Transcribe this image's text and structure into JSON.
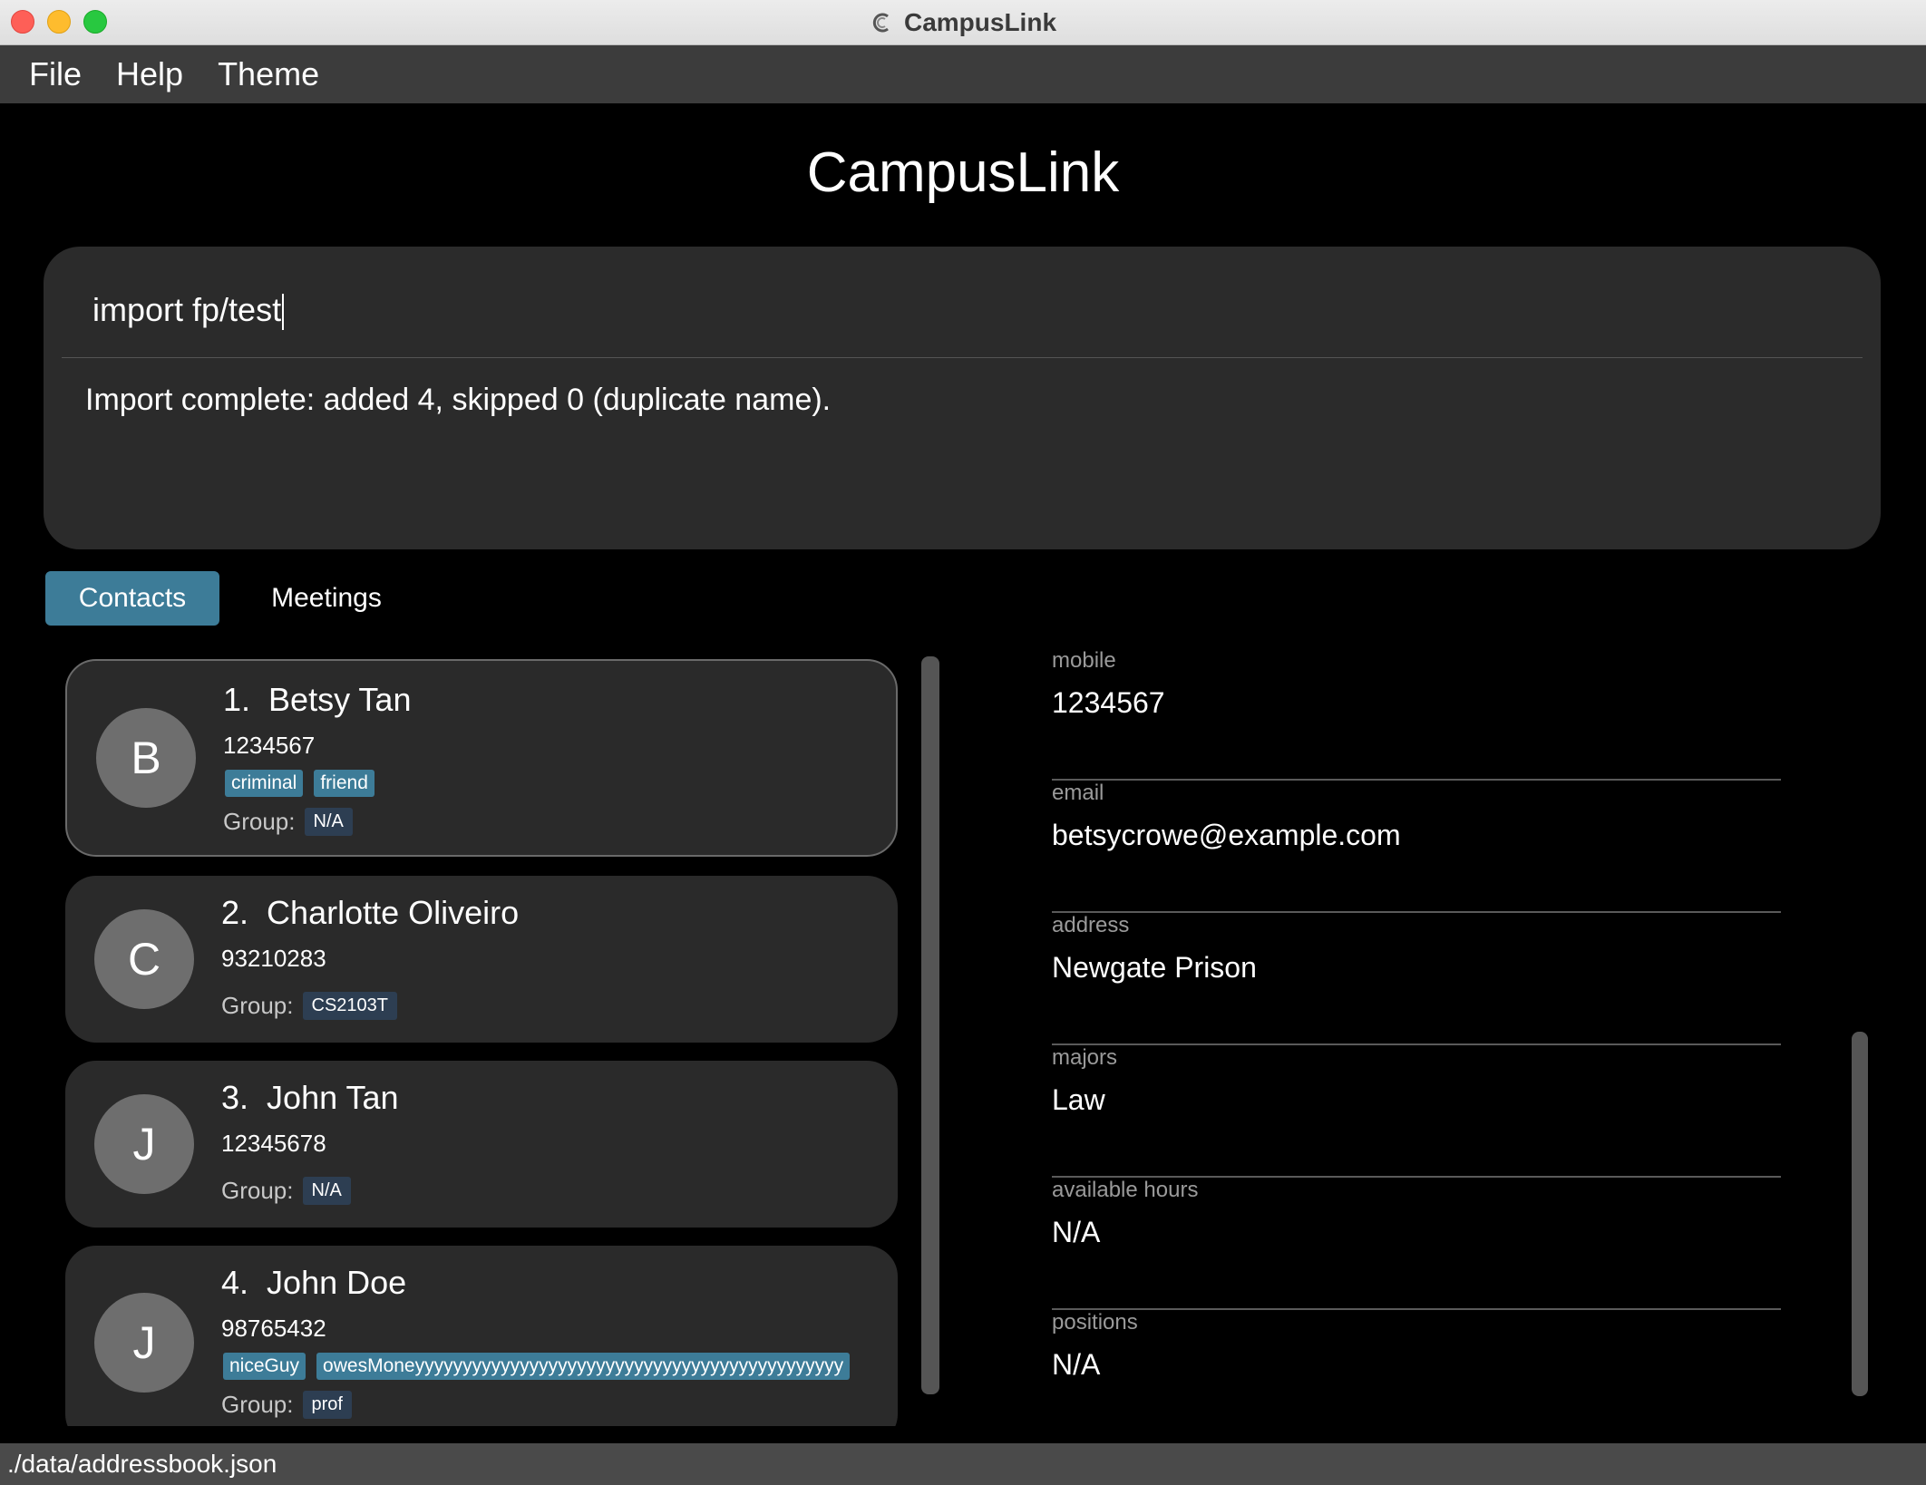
{
  "window": {
    "title": "CampusLink"
  },
  "menu": {
    "file": "File",
    "help": "Help",
    "theme": "Theme"
  },
  "header": {
    "title": "CampusLink"
  },
  "command": {
    "input_value": "import fp/test",
    "result": "Import complete: added 4, skipped 0 (duplicate name)."
  },
  "tabs": {
    "contacts": "Contacts",
    "meetings": "Meetings",
    "active": "Contacts"
  },
  "contacts": [
    {
      "index": "1.",
      "name": "Betsy Tan",
      "initial": "B",
      "phone": "1234567",
      "tags": [
        "criminal",
        "friend"
      ],
      "group_label": "Group:",
      "group": "N/A",
      "selected": true
    },
    {
      "index": "2.",
      "name": "Charlotte Oliveiro",
      "initial": "C",
      "phone": "93210283",
      "tags": [],
      "group_label": "Group:",
      "group": "CS2103T",
      "selected": false
    },
    {
      "index": "3.",
      "name": "John Tan",
      "initial": "J",
      "phone": "12345678",
      "tags": [],
      "group_label": "Group:",
      "group": "N/A",
      "selected": false
    },
    {
      "index": "4.",
      "name": "John Doe",
      "initial": "J",
      "phone": "98765432",
      "tags": [
        "niceGuy",
        "owesMoneyyyyyyyyyyyyyyyyyyyyyyyyyyyyyyyyyyyyyyyyyyyyy"
      ],
      "group_label": "Group:",
      "group": "prof",
      "selected": false
    }
  ],
  "details": {
    "mobile_label": "mobile",
    "mobile": "1234567",
    "email_label": "email",
    "email": "betsycrowe@example.com",
    "address_label": "address",
    "address": "Newgate Prison",
    "majors_label": "majors",
    "majors": "Law",
    "hours_label": "available hours",
    "hours": "N/A",
    "positions_label": "positions",
    "positions": "N/A"
  },
  "status": {
    "path": "./data/addressbook.json"
  },
  "colors": {
    "accent": "#3d7c98",
    "group_tag": "#2d3e52",
    "card": "#2a2a2a",
    "panel": "#2b2b2b"
  }
}
